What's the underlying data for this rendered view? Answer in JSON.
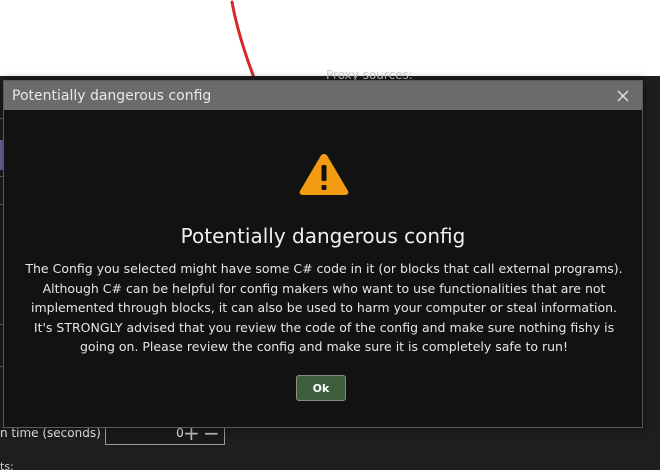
{
  "background": {
    "partial_heading": "Proxy sources:",
    "time_field": {
      "label": "n time (seconds)",
      "value": "0"
    },
    "bottom_fragment": "ts:"
  },
  "dialog": {
    "title": "Potentially dangerous config",
    "heading": "Potentially dangerous config",
    "message": "The Config you selected might have some C# code in it (or blocks that call external programs). Although C# can be helpful for config makers who want to use functionalities that are not implemented through blocks, it can also be used to harm your computer or steal information. It's STRONGLY advised that you review the code of the config and make sure nothing fishy is going on. Please review the config and make sure it is completely safe to run!",
    "ok_label": "Ok",
    "icons": {
      "close": "close-icon",
      "warning": "warning-icon"
    }
  },
  "colors": {
    "titlebar": "#6b6b6b",
    "dialog_bg": "#121212",
    "warning": "#f39c12",
    "ok_button": "#3d5e3d",
    "annotation_stroke": "#d62828"
  }
}
